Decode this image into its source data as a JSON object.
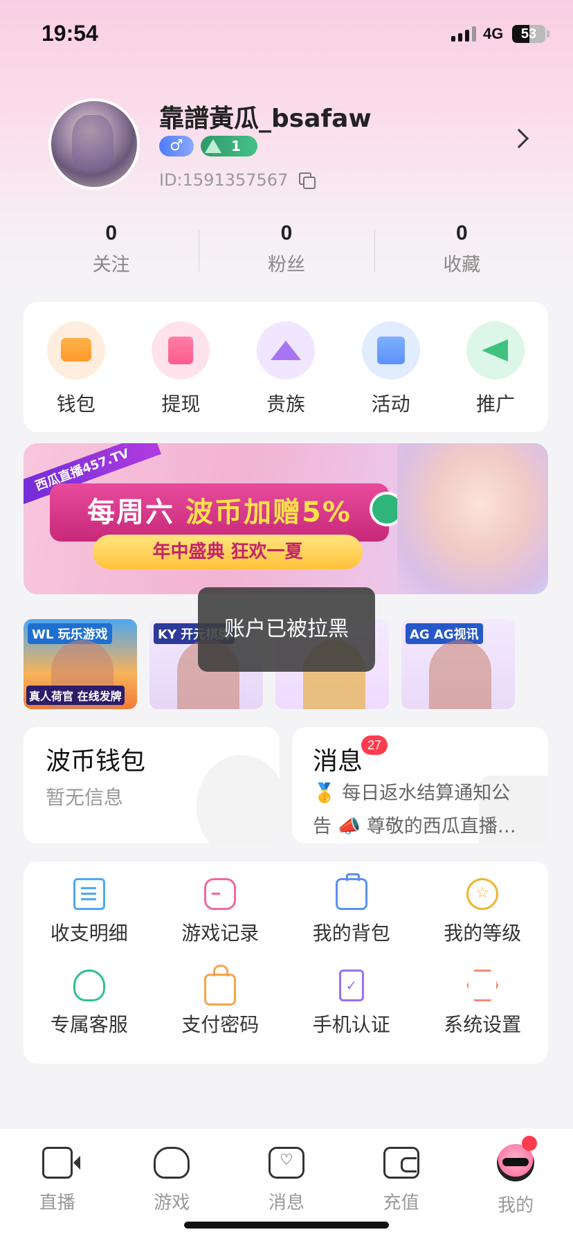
{
  "status_bar": {
    "time": "19:54",
    "network": "4G",
    "battery": "53",
    "battery_level": 0.53
  },
  "profile": {
    "username": "靠譜黃瓜_bsafaw",
    "gender_symbol": "♂",
    "level": "1",
    "user_id": "ID:1591357567"
  },
  "stats": [
    {
      "value": "0",
      "label": "关注"
    },
    {
      "value": "0",
      "label": "粉丝"
    },
    {
      "value": "0",
      "label": "收藏"
    }
  ],
  "quick_actions": [
    {
      "label": "钱包",
      "icon": "wallet-icon"
    },
    {
      "label": "提现",
      "icon": "withdraw-icon"
    },
    {
      "label": "贵族",
      "icon": "crown-icon"
    },
    {
      "label": "活动",
      "icon": "gift-icon"
    },
    {
      "label": "推广",
      "icon": "megaphone-icon"
    }
  ],
  "banner": {
    "tag": "西瓜直播457.TV",
    "headline_prefix": "每周六 ",
    "headline_highlight": "波币加赠5%",
    "subline": "年中盛典 狂欢一夏"
  },
  "games": [
    {
      "logo": "WL 玩乐游戏",
      "caption": "真人荷官 在线发牌"
    },
    {
      "logo": "KY 开元棋牌"
    },
    {
      "logo": ""
    },
    {
      "logo": "AG AG视讯"
    }
  ],
  "toast": {
    "text": "账户已被拉黑"
  },
  "wallet_card": {
    "title": "波币钱包",
    "subtitle": "暂无信息"
  },
  "message_card": {
    "title": "消息",
    "badge": "27",
    "preview": "🥇 每日返水结算通知公告 📣 尊敬的西瓜直播…"
  },
  "menu": [
    {
      "label": "收支明细",
      "icon": "ledger-icon"
    },
    {
      "label": "游戏记录",
      "icon": "gamepad-icon"
    },
    {
      "label": "我的背包",
      "icon": "backpack-icon"
    },
    {
      "label": "我的等级",
      "icon": "star-badge-icon"
    },
    {
      "label": "专属客服",
      "icon": "headset-icon"
    },
    {
      "label": "支付密码",
      "icon": "lock-icon"
    },
    {
      "label": "手机认证",
      "icon": "phone-check-icon"
    },
    {
      "label": "系统设置",
      "icon": "settings-icon"
    }
  ],
  "tabbar": [
    {
      "label": "直播",
      "icon": "video-camera-icon"
    },
    {
      "label": "游戏",
      "icon": "controller-icon"
    },
    {
      "label": "消息",
      "icon": "chat-heart-icon"
    },
    {
      "label": "充值",
      "icon": "wallet-icon"
    },
    {
      "label": "我的",
      "icon": "profile-avatar-icon",
      "active": true
    }
  ],
  "colors": {
    "accent_pink": "#f2689a",
    "badge_red": "#ff3b4e",
    "level_green": "#2f9a6a",
    "gender_blue": "#4e7dfb"
  }
}
